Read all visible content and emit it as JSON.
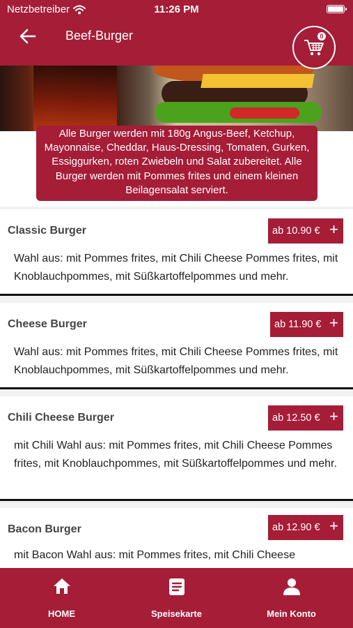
{
  "status_bar": {
    "carrier": "Netzbetreiber",
    "time": "11:26 PM"
  },
  "header": {
    "title": "Beef-Burger",
    "cart_count": "0"
  },
  "info": {
    "text": "Alle Burger werden mit 180g Angus-Beef, Ketchup, Mayonnaise, Cheddar, Haus-Dressing, Tomaten, Gurken, Essiggurken, roten Zwiebeln und Salat zubereitet. Alle Burger werden mit Pommes frites und einem kleinen Beilagensalat serviert."
  },
  "menu": {
    "items": [
      {
        "name": "Classic Burger",
        "price": "ab 10.90 €",
        "description": "Wahl aus: mit Pommes frites, mit Chili Cheese Pommes frites, mit Knoblauchpommes, mit Süßkartoffelpommes und mehr."
      },
      {
        "name": "Cheese Burger",
        "price": "ab 11.90 €",
        "description": "Wahl aus: mit Pommes frites, mit Chili Cheese Pommes frites, mit Knoblauchpommes, mit Süßkartoffelpommes und mehr."
      },
      {
        "name": "Chili Cheese Burger",
        "price": "ab 12.50 €",
        "description": "mit Chili Wahl aus: mit Pommes frites, mit Chili Cheese Pommes frites, mit Knoblauchpommes, mit Süßkartoffelpommes und mehr."
      },
      {
        "name": "Bacon Burger",
        "price": "ab 12.90 €",
        "description": "mit Bacon Wahl aus: mit Pommes frites, mit Chili Cheese"
      }
    ],
    "add_symbol": "+"
  },
  "tabs": [
    {
      "label": "HOME",
      "icon": "home-icon"
    },
    {
      "label": "Speisekarte",
      "icon": "menu-card-icon"
    },
    {
      "label": "Mein Konto",
      "icon": "user-icon"
    }
  ],
  "colors": {
    "brand": "#a51d37",
    "background": "#f2f2f2",
    "text": "#222222"
  }
}
